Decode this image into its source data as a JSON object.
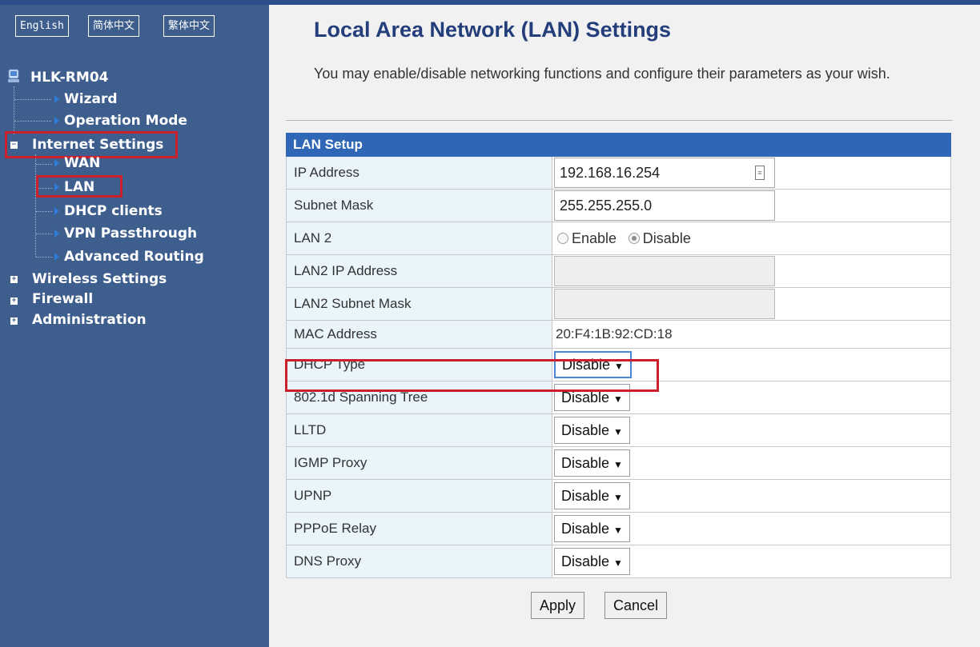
{
  "languages": [
    "English",
    "简体中文",
    "繁体中文"
  ],
  "nav": {
    "root": "HLK-RM04",
    "items": [
      {
        "label": "Wizard"
      },
      {
        "label": "Operation Mode"
      },
      {
        "label": "Internet Settings",
        "expand": "−"
      },
      {
        "label": "WAN"
      },
      {
        "label": "LAN"
      },
      {
        "label": "DHCP clients"
      },
      {
        "label": "VPN Passthrough"
      },
      {
        "label": "Advanced Routing"
      },
      {
        "label": "Wireless Settings",
        "expand": "+"
      },
      {
        "label": "Firewall",
        "expand": "+"
      },
      {
        "label": "Administration",
        "expand": "+"
      }
    ]
  },
  "page": {
    "title": "Local Area Network (LAN) Settings",
    "description": "You may enable/disable networking functions and configure their parameters as your wish."
  },
  "lan": {
    "header": "LAN Setup",
    "ip_label": "IP Address",
    "ip_value": "192.168.16.254",
    "mask_label": "Subnet Mask",
    "mask_value": "255.255.255.0",
    "lan2_label": "LAN 2",
    "lan2_enable": "Enable",
    "lan2_disable": "Disable",
    "lan2_ip_label": "LAN2 IP Address",
    "lan2_mask_label": "LAN2 Subnet Mask",
    "mac_label": "MAC Address",
    "mac_value": "20:F4:1B:92:CD:18",
    "selects": [
      {
        "label": "DHCP Type",
        "value": "Disable"
      },
      {
        "label": "802.1d Spanning Tree",
        "value": "Disable"
      },
      {
        "label": "LLTD",
        "value": "Disable"
      },
      {
        "label": "IGMP Proxy",
        "value": "Disable"
      },
      {
        "label": "UPNP",
        "value": "Disable"
      },
      {
        "label": "PPPoE Relay",
        "value": "Disable"
      },
      {
        "label": "DNS Proxy",
        "value": "Disable"
      }
    ],
    "dropdown_glyph": "▼"
  },
  "buttons": {
    "apply": "Apply",
    "cancel": "Cancel"
  },
  "colors": {
    "sidebar": "#3e5e8e",
    "title": "#233e7a",
    "header": "#2f67b6",
    "highlight": "#cc1f2c"
  }
}
